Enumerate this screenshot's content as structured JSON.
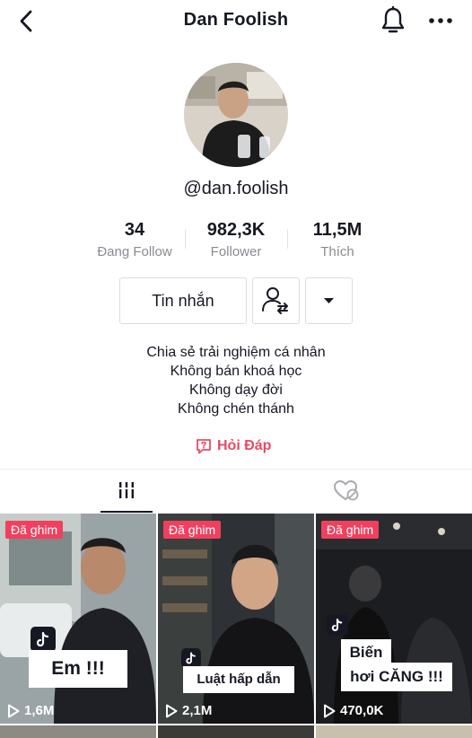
{
  "header": {
    "title": "Dan Foolish",
    "back_icon": "chevron-left-icon",
    "bell_icon": "bell-icon",
    "more_icon": "more-icon"
  },
  "profile": {
    "username": "@dan.foolish"
  },
  "stats": [
    {
      "value": "34",
      "label": "Đang Follow"
    },
    {
      "value": "982,3K",
      "label": "Follower"
    },
    {
      "value": "11,5M",
      "label": "Thích"
    }
  ],
  "actions": {
    "message": "Tin nhắn",
    "friend_icon": "add-friend-icon",
    "dropdown_icon": "caret-down-icon"
  },
  "bio": [
    "Chia sẻ trải nghiệm cá nhân",
    "Không bán khoá học",
    "Không dạy đời",
    "Không chén thánh"
  ],
  "qa": {
    "label": "Hỏi Đáp",
    "icon": "question-bubble-icon"
  },
  "tabs": [
    {
      "icon": "grid-icon",
      "active": true
    },
    {
      "icon": "liked-hidden-icon",
      "active": false
    }
  ],
  "videos": [
    {
      "pinned": "Đã ghim",
      "caption": "Em !!!",
      "views": "1,6M"
    },
    {
      "pinned": "Đã ghim",
      "caption": "Luật hấp dẫn",
      "views": "2,1M"
    },
    {
      "pinned": "Đã ghim",
      "caption_line1": "Biến",
      "caption_line2": "hơi CĂNG !!!",
      "views": "470,0K"
    }
  ],
  "colors": {
    "accent": "#f0405e",
    "link": "#e84a64",
    "text": "#161823",
    "muted": "#8a8b91"
  }
}
